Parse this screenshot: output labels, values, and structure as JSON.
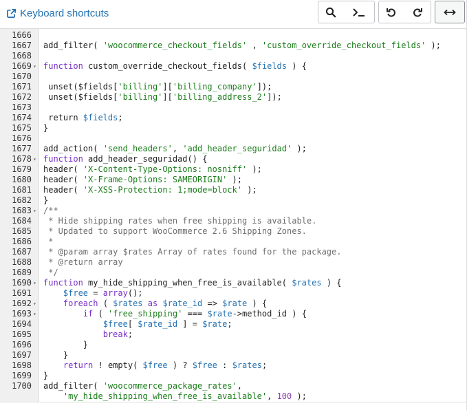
{
  "toolbar": {
    "shortcuts_label": "Keyboard shortcuts"
  },
  "editor": {
    "lines": [
      {
        "n": "1666",
        "fold": false,
        "segs": []
      },
      {
        "n": "1667",
        "fold": false,
        "segs": [
          [
            "p",
            "add_filter( "
          ],
          [
            "s",
            "'woocommerce_checkout_fields'"
          ],
          [
            "p",
            " , "
          ],
          [
            "s",
            "'custom_override_checkout_fields'"
          ],
          [
            "p",
            " );"
          ]
        ]
      },
      {
        "n": "1668",
        "fold": false,
        "segs": []
      },
      {
        "n": "1669",
        "fold": true,
        "segs": [
          [
            "k",
            "function"
          ],
          [
            "p",
            " custom_override_checkout_fields( "
          ],
          [
            "v",
            "$fields"
          ],
          [
            "p",
            " ) {"
          ]
        ]
      },
      {
        "n": "1670",
        "fold": false,
        "segs": []
      },
      {
        "n": "1671",
        "fold": false,
        "segs": [
          [
            "p",
            " unset($fields["
          ],
          [
            "s",
            "'billing'"
          ],
          [
            "p",
            "]["
          ],
          [
            "s",
            "'billing_company'"
          ],
          [
            "p",
            "]);"
          ]
        ]
      },
      {
        "n": "1672",
        "fold": false,
        "segs": [
          [
            "p",
            " unset($fields["
          ],
          [
            "s",
            "'billing'"
          ],
          [
            "p",
            "]["
          ],
          [
            "s",
            "'billing_address_2'"
          ],
          [
            "p",
            "]);"
          ]
        ]
      },
      {
        "n": "1673",
        "fold": false,
        "segs": []
      },
      {
        "n": "1674",
        "fold": false,
        "segs": [
          [
            "p",
            " return "
          ],
          [
            "v",
            "$fields"
          ],
          [
            "p",
            ";"
          ]
        ]
      },
      {
        "n": "1675",
        "fold": false,
        "segs": [
          [
            "p",
            "}"
          ]
        ]
      },
      {
        "n": "1676",
        "fold": false,
        "segs": []
      },
      {
        "n": "1677",
        "fold": false,
        "segs": [
          [
            "p",
            "add_action( "
          ],
          [
            "s",
            "'send_headers'"
          ],
          [
            "p",
            ", "
          ],
          [
            "s",
            "'add_header_seguridad'"
          ],
          [
            "p",
            " );"
          ]
        ]
      },
      {
        "n": "1678",
        "fold": true,
        "segs": [
          [
            "k",
            "function"
          ],
          [
            "p",
            " add_header_seguridad() {"
          ]
        ]
      },
      {
        "n": "1679",
        "fold": false,
        "segs": [
          [
            "p",
            "header( "
          ],
          [
            "s",
            "'X-Content-Type-Options: nosniff'"
          ],
          [
            "p",
            " );"
          ]
        ]
      },
      {
        "n": "1680",
        "fold": false,
        "segs": [
          [
            "p",
            "header( "
          ],
          [
            "s",
            "'X-Frame-Options: SAMEORIGIN'"
          ],
          [
            "p",
            " );"
          ]
        ]
      },
      {
        "n": "1681",
        "fold": false,
        "segs": [
          [
            "p",
            "header( "
          ],
          [
            "s",
            "'X-XSS-Protection: 1;mode=block'"
          ],
          [
            "p",
            " );"
          ]
        ]
      },
      {
        "n": "1682",
        "fold": false,
        "segs": [
          [
            "p",
            "}"
          ]
        ]
      },
      {
        "n": "1683",
        "fold": true,
        "segs": [
          [
            "c",
            "/**"
          ]
        ]
      },
      {
        "n": "1684",
        "fold": false,
        "segs": [
          [
            "c",
            " * Hide shipping rates when free shipping is available."
          ]
        ]
      },
      {
        "n": "1685",
        "fold": false,
        "segs": [
          [
            "c",
            " * Updated to support WooCommerce 2.6 Shipping Zones."
          ]
        ]
      },
      {
        "n": "1686",
        "fold": false,
        "segs": [
          [
            "c",
            " *"
          ]
        ]
      },
      {
        "n": "1687",
        "fold": false,
        "segs": [
          [
            "c",
            " * @param array $rates Array of rates found for the package."
          ]
        ]
      },
      {
        "n": "1688",
        "fold": false,
        "segs": [
          [
            "c",
            " * @return array"
          ]
        ]
      },
      {
        "n": "1689",
        "fold": false,
        "segs": [
          [
            "c",
            " */"
          ]
        ]
      },
      {
        "n": "1690",
        "fold": true,
        "segs": [
          [
            "k",
            "function"
          ],
          [
            "p",
            " my_hide_shipping_when_free_is_available( "
          ],
          [
            "v",
            "$rates"
          ],
          [
            "p",
            " ) {"
          ]
        ]
      },
      {
        "n": "1691",
        "fold": false,
        "segs": [
          [
            "p",
            "    "
          ],
          [
            "v",
            "$free"
          ],
          [
            "p",
            " = "
          ],
          [
            "k",
            "array"
          ],
          [
            "p",
            "();"
          ]
        ]
      },
      {
        "n": "1692",
        "fold": true,
        "segs": [
          [
            "p",
            "    "
          ],
          [
            "k",
            "foreach"
          ],
          [
            "p",
            " ( "
          ],
          [
            "v",
            "$rates"
          ],
          [
            "p",
            " "
          ],
          [
            "k",
            "as"
          ],
          [
            "p",
            " "
          ],
          [
            "v",
            "$rate_id"
          ],
          [
            "p",
            " => "
          ],
          [
            "v",
            "$rate"
          ],
          [
            "p",
            " ) {"
          ]
        ]
      },
      {
        "n": "1693",
        "fold": true,
        "segs": [
          [
            "p",
            "        "
          ],
          [
            "k",
            "if"
          ],
          [
            "p",
            " ( "
          ],
          [
            "s",
            "'free_shipping'"
          ],
          [
            "p",
            " === "
          ],
          [
            "v",
            "$rate"
          ],
          [
            "p",
            "->method_id ) {"
          ]
        ]
      },
      {
        "n": "1694",
        "fold": false,
        "segs": [
          [
            "p",
            "            "
          ],
          [
            "v",
            "$free"
          ],
          [
            "p",
            "[ "
          ],
          [
            "v",
            "$rate_id"
          ],
          [
            "p",
            " ] = "
          ],
          [
            "v",
            "$rate"
          ],
          [
            "p",
            ";"
          ]
        ]
      },
      {
        "n": "1695",
        "fold": false,
        "segs": [
          [
            "p",
            "            "
          ],
          [
            "k",
            "break"
          ],
          [
            "p",
            ";"
          ]
        ]
      },
      {
        "n": "1696",
        "fold": false,
        "segs": [
          [
            "p",
            "        }"
          ]
        ]
      },
      {
        "n": "1697",
        "fold": false,
        "segs": [
          [
            "p",
            "    }"
          ]
        ]
      },
      {
        "n": "1698",
        "fold": false,
        "segs": [
          [
            "p",
            "    "
          ],
          [
            "k",
            "return"
          ],
          [
            "p",
            " ! empty( "
          ],
          [
            "v",
            "$free"
          ],
          [
            "p",
            " ) ? "
          ],
          [
            "v",
            "$free"
          ],
          [
            "p",
            " : "
          ],
          [
            "v",
            "$rates"
          ],
          [
            "p",
            ";"
          ]
        ]
      },
      {
        "n": "1699",
        "fold": false,
        "segs": [
          [
            "p",
            "}"
          ]
        ]
      },
      {
        "n": "1700",
        "fold": false,
        "segs": [
          [
            "p",
            "add_filter( "
          ],
          [
            "s",
            "'woocommerce_package_rates'"
          ],
          [
            "p",
            ","
          ]
        ]
      },
      {
        "n": "",
        "fold": false,
        "segs": [
          [
            "p",
            "    "
          ],
          [
            "s",
            "'my_hide_shipping_when_free_is_available'"
          ],
          [
            "p",
            ", "
          ],
          [
            "d",
            "100"
          ],
          [
            "p",
            " );"
          ]
        ]
      }
    ]
  }
}
